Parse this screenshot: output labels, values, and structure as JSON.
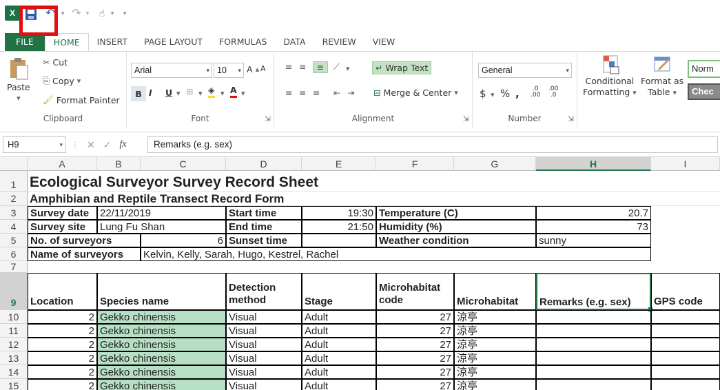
{
  "qat": {
    "excel_icon": "X",
    "undo": "↶",
    "redo": "↷",
    "touch": "☝",
    "more": "▾"
  },
  "tabs": [
    "FILE",
    "HOME",
    "INSERT",
    "PAGE LAYOUT",
    "FORMULAS",
    "DATA",
    "REVIEW",
    "VIEW"
  ],
  "ribbon": {
    "clipboard": {
      "paste": "Paste",
      "cut": "Cut",
      "copy": "Copy",
      "format_painter": "Format Painter",
      "label": "Clipboard"
    },
    "font": {
      "name": "Arial",
      "size": "10",
      "label": "Font",
      "bold": "B",
      "italic": "I",
      "underline": "U"
    },
    "alignment": {
      "wrap": "Wrap Text",
      "merge": "Merge & Center",
      "label": "Alignment"
    },
    "number": {
      "format": "General",
      "currency": "$",
      "percent": "%",
      "comma": ",",
      "label": "Number"
    },
    "styles": {
      "conditional": "Conditional",
      "conditional2": "Formatting",
      "format_as": "Format as",
      "table": "Table",
      "normal": "Norm",
      "check": "Chec"
    }
  },
  "formula_bar": {
    "name_box": "H9",
    "content": "Remarks (e.g. sex)"
  },
  "columns": [
    "A",
    "B",
    "C",
    "D",
    "E",
    "F",
    "G",
    "H",
    "I"
  ],
  "rows": [
    "1",
    "2",
    "3",
    "4",
    "5",
    "6",
    "7",
    "9",
    "10",
    "11",
    "12",
    "13",
    "14",
    "15"
  ],
  "sheet": {
    "title": "Ecological Surveyor Survey Record Sheet",
    "subtitle": "Amphibian and Reptile Transect Record Form",
    "survey_date_label": "Survey date",
    "survey_date": "22/11/2019",
    "survey_site_label": "Survey site",
    "survey_site": "Lung Fu Shan",
    "no_surveyors_label": "No. of surveyors",
    "no_surveyors": "6",
    "names_label": "Name of surveyors",
    "names": "Kelvin, Kelly, Sarah, Hugo, Kestrel, Rachel",
    "start_label": "Start time",
    "start": "19:30",
    "end_label": "End time",
    "end": "21:50",
    "sunset_label": "Sunset time",
    "temp_label": "Temperature (C)",
    "temp": "20.7",
    "humidity_label": "Humidity (%)",
    "humidity": "73",
    "weather_label": "Weather condition",
    "weather": "sunny",
    "headers": {
      "location": "Location",
      "species": "Species name",
      "detection1": "Detection",
      "detection2": "method",
      "stage": "Stage",
      "micro_code1": "Microhabitat",
      "micro_code2": "code",
      "microhabitat": "Microhabitat",
      "remarks": "Remarks (e.g. sex)",
      "gps": "GPS code"
    },
    "records": [
      {
        "loc": "2",
        "species": "Gekko chinensis",
        "method": "Visual",
        "stage": "Adult",
        "code": "27",
        "habitat": "涼亭"
      },
      {
        "loc": "2",
        "species": "Gekko chinensis",
        "method": "Visual",
        "stage": "Adult",
        "code": "27",
        "habitat": "涼亭"
      },
      {
        "loc": "2",
        "species": "Gekko chinensis",
        "method": "Visual",
        "stage": "Adult",
        "code": "27",
        "habitat": "涼亭"
      },
      {
        "loc": "2",
        "species": "Gekko chinensis",
        "method": "Visual",
        "stage": "Adult",
        "code": "27",
        "habitat": "涼亭"
      },
      {
        "loc": "2",
        "species": "Gekko chinensis",
        "method": "Visual",
        "stage": "Adult",
        "code": "27",
        "habitat": "涼亭"
      },
      {
        "loc": "2",
        "species": "Gekko chinensis",
        "method": "Visual",
        "stage": "Adult",
        "code": "27",
        "habitat": "涼亭"
      }
    ]
  }
}
